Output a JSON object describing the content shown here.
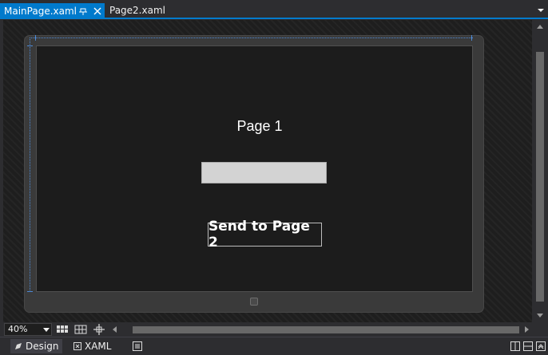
{
  "tabs": {
    "active": {
      "label": "MainPage.xaml",
      "pin_icon": "pin-icon",
      "close_icon": "close-icon"
    },
    "inactive": {
      "label": "Page2.xaml"
    },
    "dropdown_icon": "chevron-down-icon"
  },
  "design_surface": {
    "page_title": "Page 1",
    "textbox_value": "",
    "send_button_label": "Send to Page 2"
  },
  "bottom_toolbar": {
    "zoom_level": "40%",
    "icons": [
      "grid-icon",
      "snap-grid-icon",
      "snap-lines-icon"
    ]
  },
  "view_tabs": {
    "design_label": "Design",
    "xaml_label": "XAML"
  },
  "colors": {
    "accent": "#007acc",
    "chrome": "#2d2d30",
    "surface": "#1e1e1e"
  }
}
